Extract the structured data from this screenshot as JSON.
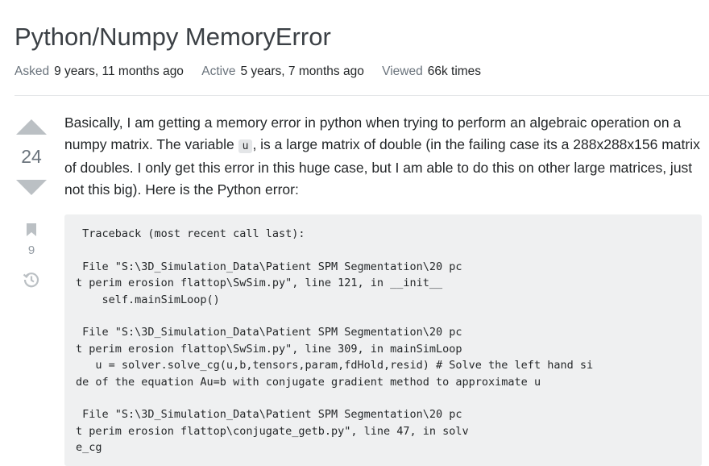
{
  "question": {
    "title": "Python/Numpy MemoryError",
    "meta": {
      "asked_label": "Asked",
      "asked_value": "9 years, 11 months ago",
      "active_label": "Active",
      "active_value": "5 years, 7 months ago",
      "viewed_label": "Viewed",
      "viewed_value": "66k times"
    },
    "score": "24",
    "favorite_count": "9",
    "body": {
      "text_before_code": "Basically, I am getting a memory error in python when trying to perform an algebraic operation on a numpy matrix. The variable ",
      "inline_code": "u",
      "text_after_code": ", is a large matrix of double (in the failing case its a 288x288x156 matrix of doubles. I only get this error in this huge case, but I am able to do this on other large matrices, just not this big). Here is the Python error:"
    },
    "code_block": " Traceback (most recent call last):\n\n File \"S:\\3D_Simulation_Data\\Patient SPM Segmentation\\20 pc\nt perim erosion flattop\\SwSim.py\", line 121, in __init__\n    self.mainSimLoop()\n\n File \"S:\\3D_Simulation_Data\\Patient SPM Segmentation\\20 pc\nt perim erosion flattop\\SwSim.py\", line 309, in mainSimLoop\n   u = solver.solve_cg(u,b,tensors,param,fdHold,resid) # Solve the left hand si\nde of the equation Au=b with conjugate gradient method to approximate u\n\n File \"S:\\3D_Simulation_Data\\Patient SPM Segmentation\\20 pc\nt perim erosion flattop\\conjugate_getb.py\", line 47, in solv\ne_cg"
  },
  "icons": {
    "upvote": "upvote-arrow-icon",
    "downvote": "downvote-arrow-icon",
    "bookmark": "bookmark-icon",
    "history": "history-icon"
  },
  "colors": {
    "vote_arrow": "#bbc0c4",
    "code_background": "#eff0f1",
    "meta_label": "#6a737c"
  }
}
